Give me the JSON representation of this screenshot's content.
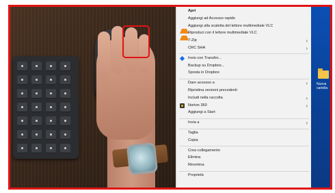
{
  "context_menu": {
    "items": [
      {
        "label": "Apri",
        "bold": true
      },
      {
        "label": "Aggiungi ad Accesso rapido"
      },
      {
        "label": "Aggiungi alla scaletta del lettore multimediale VLC",
        "icon": "vlc-cone-icon"
      },
      {
        "label": "Riproduci con il lettore multimediale VLC",
        "icon": "vlc-cone-icon"
      },
      {
        "label": "7-Zip",
        "submenu": true
      },
      {
        "label": "CRC SHA",
        "submenu": true
      },
      {
        "label": "Invio con Transfer...",
        "icon": "dropbox-icon"
      },
      {
        "label": "Backup su Dropbox..."
      },
      {
        "label": "Sposta in Dropbox"
      },
      {
        "label": "Dare accesso a",
        "submenu": true
      },
      {
        "label": "Ripristina versioni precedenti"
      },
      {
        "label": "Includi nella raccolta",
        "submenu": true
      },
      {
        "label": "Norton 360",
        "icon": "norton-icon",
        "submenu": true
      },
      {
        "label": "Aggiungi a Start"
      },
      {
        "label": "Invia a",
        "submenu": true
      },
      {
        "label": "Taglia"
      },
      {
        "label": "Copia"
      },
      {
        "label": "Crea collegamento"
      },
      {
        "label": "Elimina"
      },
      {
        "label": "Rinomina"
      },
      {
        "label": "Proprietà"
      }
    ],
    "submenu_arrow": "›"
  },
  "desktop": {
    "icon_label": "Nuova cartella"
  },
  "colors": {
    "highlight_border": "#e01414",
    "menu_background": "#f2f2f2",
    "desktop_blue": "#0b4fb3",
    "vlc_orange": "#f08a18",
    "dropbox_blue": "#1a6cf0"
  }
}
